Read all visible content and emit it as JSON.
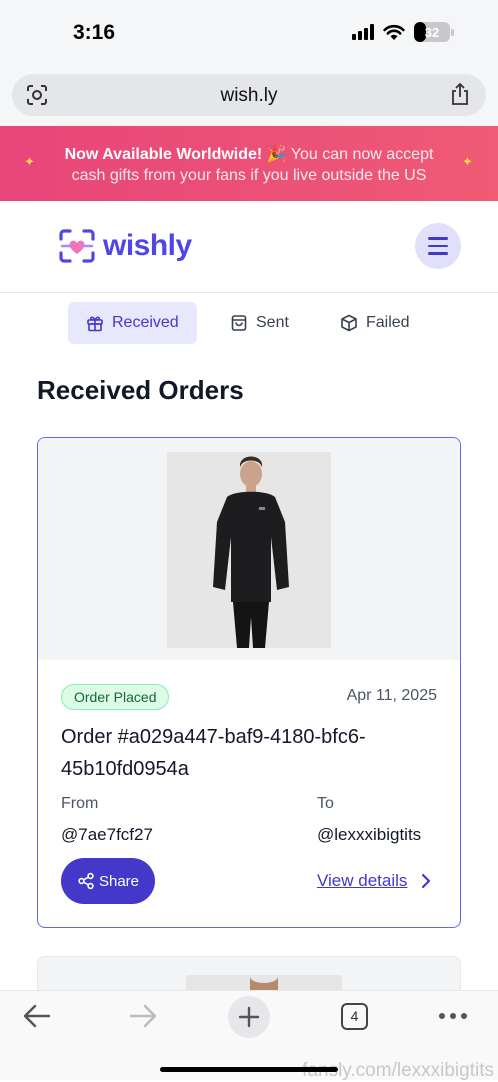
{
  "status_bar": {
    "time": "3:16",
    "battery": "32",
    "battery_level": 0.32
  },
  "browser": {
    "url": "wish.ly"
  },
  "promo": {
    "headline": "Now Available Worldwide! 🎉",
    "text_part1": "You can now accept",
    "text_part2": "cash gifts from your fans if you live outside the US"
  },
  "header": {
    "logo_text": "wishly",
    "brand_color": "#4f46e5"
  },
  "tabs": [
    {
      "label": "Received",
      "icon": "gift-icon",
      "active": true
    },
    {
      "label": "Sent",
      "icon": "shopping-bag-icon",
      "active": false
    },
    {
      "label": "Failed",
      "icon": "box-icon",
      "active": false
    }
  ],
  "main": {
    "title": "Received Orders"
  },
  "orders": [
    {
      "status": "Order Placed",
      "date": "Apr 11, 2025",
      "order_id": "Order #a029a447-baf9-4180-bfc6-45b10fd0954a",
      "from_label": "From",
      "from_value": "@7ae7fcf27",
      "to_label": "To",
      "to_value": "@lexxxibigtits",
      "share_label": "Share",
      "view_details_label": "View details"
    }
  ],
  "bottom_nav": {
    "tab_count": "4"
  },
  "watermark": "fansly.com/lexxxibigtits"
}
